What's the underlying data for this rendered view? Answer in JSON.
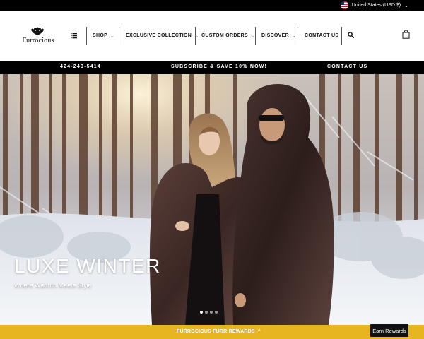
{
  "topbar": {
    "locale_label": "United States (USD $)",
    "flag_icon": "us-flag-icon",
    "chevron_icon": "chevron-down-icon"
  },
  "header": {
    "logo_text": "Furrocious",
    "menu_icon": "list-icon",
    "nav": [
      {
        "label": "SHOP",
        "has_dropdown": true
      },
      {
        "label": "EXCLUSIVE COLLECTION",
        "has_dropdown": true
      },
      {
        "label": "CUSTOM ORDERS",
        "has_dropdown": true
      },
      {
        "label": "DISCOVER",
        "has_dropdown": true
      },
      {
        "label": "CONTACT US",
        "has_dropdown": false
      }
    ],
    "search_icon": "search-icon",
    "cart_icon": "shopping-bag-icon"
  },
  "announcement": {
    "phone": "424-243-5414",
    "promo": "SUBSCRIBE & SAVE 10% NOW!",
    "contact": "CONTACT US"
  },
  "hero": {
    "title": "LUXE WINTER",
    "subtitle": "Where Warmth Meets Style",
    "slide_count": 4,
    "active_slide": 1
  },
  "rewards": {
    "label": "FURROCIOUS FURR REWARDS",
    "chevron": "^",
    "earn_button": "Earn Rewards"
  },
  "colors": {
    "black": "#000000",
    "rewards_gold": "#e6b520",
    "white": "#ffffff"
  }
}
